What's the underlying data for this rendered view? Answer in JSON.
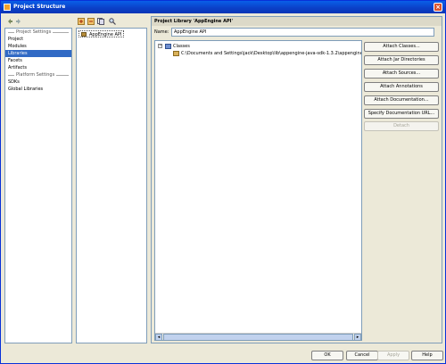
{
  "window": {
    "title": "Project Structure"
  },
  "icons": {
    "app": "app-icon",
    "close": "close-icon",
    "back": "arrow-left-icon",
    "forward": "arrow-right-icon",
    "add": "add-icon",
    "remove": "remove-icon",
    "copy": "copy-icon",
    "find": "find-icon",
    "library": "library-icon",
    "classes": "classes-icon",
    "jar": "jar-icon"
  },
  "sidebar": {
    "project_settings_label": "Project Settings",
    "project_items": [
      "Project",
      "Modules",
      "Libraries",
      "Facets",
      "Artifacts"
    ],
    "selected_item": "Libraries",
    "platform_settings_label": "Platform Settings",
    "platform_items": [
      "SDKs",
      "Global Libraries"
    ]
  },
  "libraries": {
    "items": [
      "AppEngine API"
    ]
  },
  "detail": {
    "header": "Project Library 'AppEngine API'",
    "name_label": "Name:",
    "name_value": "AppEngine API",
    "tree_root": "Classes",
    "tree_child": "C:\\Documents and Settings\\jack\\Desktop\\lib\\appengine-java-sdk-1.3.2\\appengine-java-s",
    "buttons": [
      "Attach Classes...",
      "Attach Jar Directories",
      "Attach Sources...",
      "Attach Annotations",
      "Attach Documentation...",
      "Specify Documentation URL...",
      "Detach"
    ]
  },
  "footer": {
    "ok": "OK",
    "cancel": "Cancel",
    "apply": "Apply",
    "help": "Help"
  },
  "colors": {
    "selection": "#316ac5",
    "titlebar": "#0a5fe8",
    "window_bg": "#ece9d8"
  }
}
